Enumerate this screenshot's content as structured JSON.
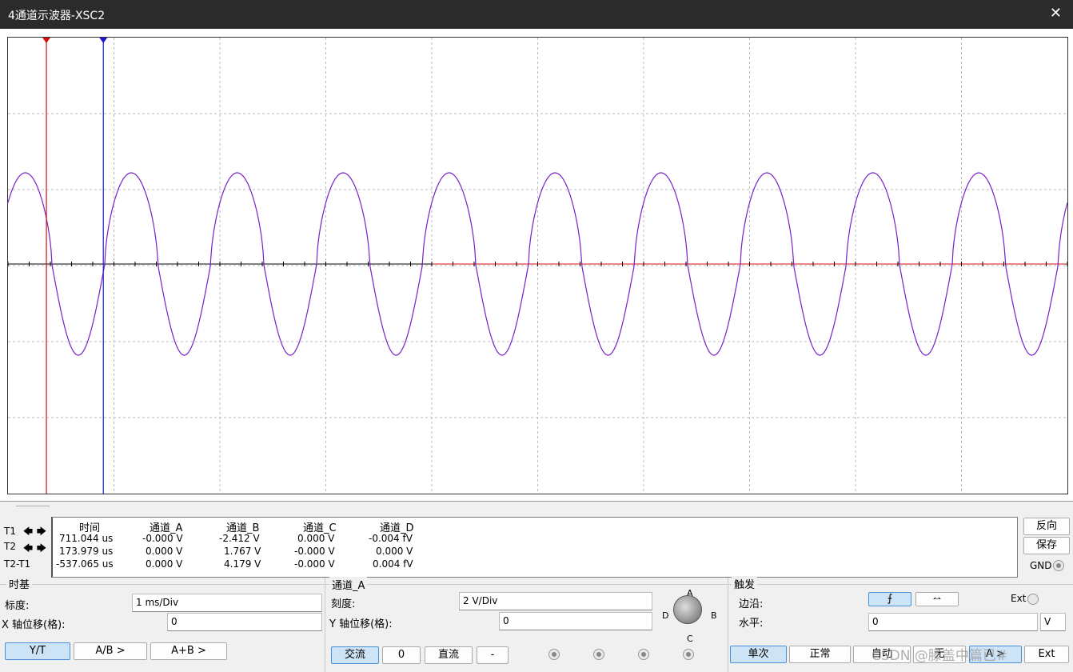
{
  "window": {
    "title": "4通道示波器-XSC2",
    "close_glyph": "✕"
  },
  "readout": {
    "headers": [
      "时间",
      "通道_A",
      "通道_B",
      "通道_C",
      "通道_D"
    ],
    "row_labels": [
      "T1",
      "T2",
      "T2-T1"
    ],
    "rows": [
      [
        "711.044 us",
        "-0.000 V",
        "-2.412 V",
        "0.000 V",
        "-0.004 fV"
      ],
      [
        "173.979 us",
        "0.000 V",
        "1.767 V",
        "-0.000 V",
        "0.000 V"
      ],
      [
        "-537.065 us",
        "0.000 V",
        "4.179 V",
        "-0.000 V",
        "0.004 fV"
      ]
    ],
    "arrow_left": "🡄",
    "arrow_right": "🡆"
  },
  "side_buttons": {
    "reverse": "反向",
    "save": "保存",
    "gnd": "GND"
  },
  "timebase": {
    "group_label": "时基",
    "scale_label": "标度:",
    "scale_value": "1 ms/Div",
    "xoffset_label": "X 轴位移(格):",
    "xoffset_value": "0",
    "modes": [
      "Y/T",
      "A/B >",
      "A+B >"
    ]
  },
  "channel": {
    "group_label": "通道_A",
    "scale_label": "刻度:",
    "scale_value": "2  V/Div",
    "yoffset_label": "Y 轴位移(格):",
    "yoffset_value": "0",
    "coupling": [
      "交流",
      "0",
      "直流",
      "-"
    ],
    "knob_labels": {
      "a": "A",
      "b": "B",
      "c": "C",
      "d": "D"
    }
  },
  "trigger": {
    "group_label": "触发",
    "edge_label": "边沿:",
    "level_label": "水平:",
    "level_value": "0",
    "level_unit": "V",
    "ext_label": "Ext",
    "edge_rising": "⨍",
    "edge_falling": "⥎",
    "modes": [
      "单次",
      "正常",
      "自动",
      "无",
      "A >",
      "Ext"
    ]
  },
  "watermark": "CSDN @滕盖中篇已#",
  "chart_data": {
    "type": "line",
    "xlabel": "",
    "ylabel": "",
    "x_divisions": 10,
    "y_divisions": 6,
    "time_per_div_ms": 1,
    "volts_per_div": 2,
    "series": [
      {
        "color": "#7a1fc9",
        "amplitude_v": 2.4,
        "cycles": 10,
        "phase_div": 0.15,
        "peak_flatten": true
      }
    ],
    "cursors": [
      {
        "label": "T1",
        "color": "#1a1acc",
        "time_us": 711.044
      },
      {
        "label": "T2",
        "color": "#d01010",
        "time_us": 173.979
      }
    ]
  }
}
